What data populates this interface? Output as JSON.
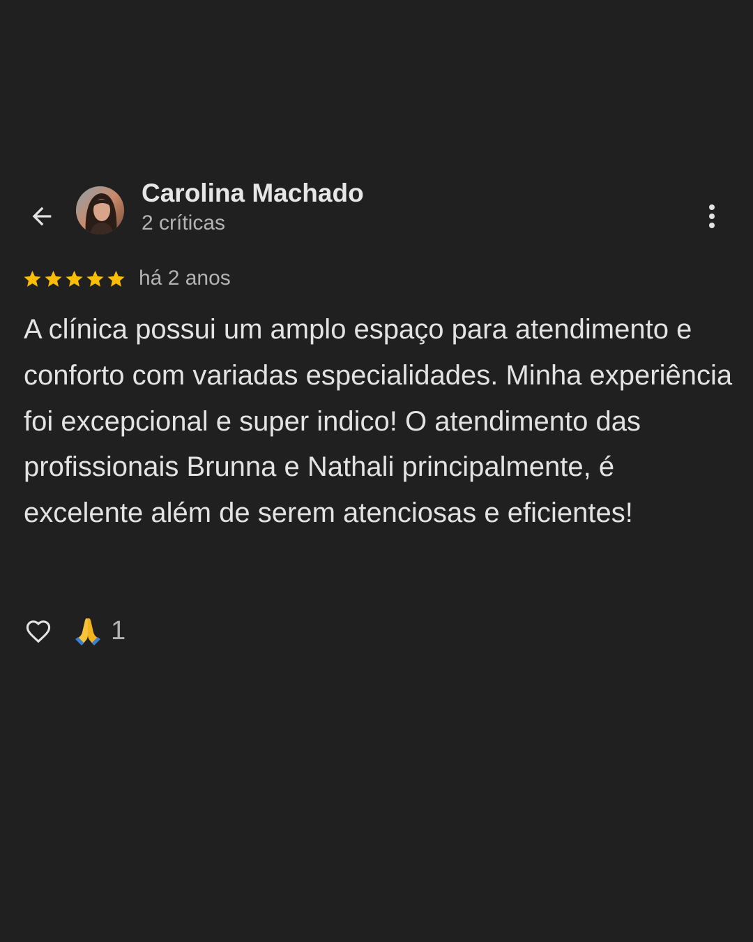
{
  "header": {
    "author_name": "Carolina Machado",
    "review_count": "2 críticas"
  },
  "review": {
    "rating": 5,
    "rating_max": 5,
    "star_color": "#fbbc04",
    "time_ago": "há 2 anos",
    "text": "A clínica possui um amplo espaço para atendimento e conforto com variadas especialidades. Minha experiência foi excepcional e super indico! O atendimento das profissionais Brunna e Nathali principalmente, é excelente além de serem atenciosas e eficientes!"
  },
  "actions": {
    "like_icon": "heart-outline-icon",
    "reaction_icon": "folded-hands-emoji",
    "reaction_count": "1"
  },
  "icons": {
    "back": "arrow-left-icon",
    "more": "more-vertical-icon"
  }
}
